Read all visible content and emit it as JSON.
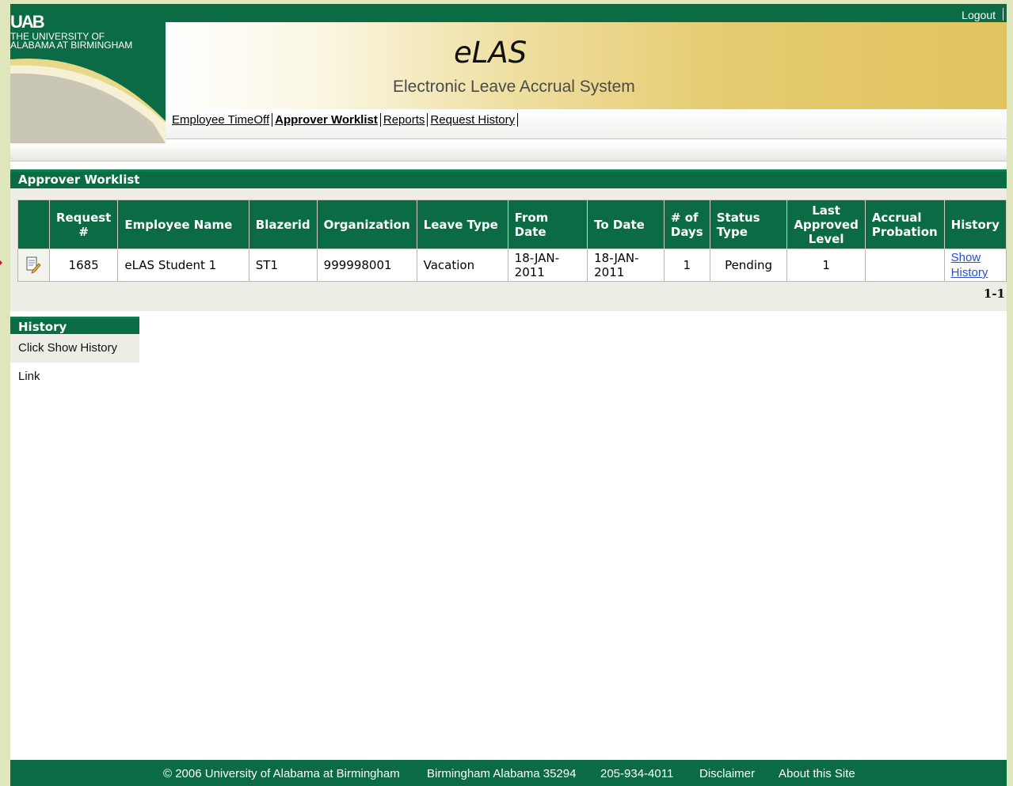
{
  "header": {
    "logo_mark": "UAB",
    "university_name": "THE UNIVERSITY OF\nALABAMA AT BIRMINGHAM",
    "logout_label": "Logout",
    "app_title": "eLAS",
    "app_subtitle": "Electronic Leave Accrual System"
  },
  "nav": {
    "items": [
      {
        "label": "Employee TimeOff"
      },
      {
        "label": "Approver Worklist"
      },
      {
        "label": "Reports"
      },
      {
        "label": "Request History"
      }
    ]
  },
  "worklist": {
    "title": "Approver Worklist",
    "columns": {
      "request": "Request #",
      "employee_name": "Employee Name",
      "blazerid": "Blazerid",
      "organization": "Organization",
      "leave_type": "Leave Type",
      "from_date": "From Date",
      "to_date": "To Date",
      "days": "# of Days",
      "status_type": "Status Type",
      "last_approved_level": "Last Approved Level",
      "accrual_probation": "Accrual Probation",
      "history": "History"
    },
    "rows": [
      {
        "request": "1685",
        "employee_name": "eLAS Student 1",
        "blazerid": "ST1",
        "organization": "999998001",
        "leave_type": "Vacation",
        "from_date": "18-JAN-2011",
        "to_date": "18-JAN-2011",
        "days": "1",
        "status_type": "Pending",
        "last_approved_level": "1",
        "accrual_probation": "",
        "history_link_line1": "Show",
        "history_link_line2": "History"
      }
    ],
    "pager": "1-1"
  },
  "history_panel": {
    "title": "History",
    "text": "Click Show History Link"
  },
  "footer": {
    "copyright": "© 2006 University of Alabama at Birmingham",
    "address": "Birmingham Alabama 35294",
    "phone": "205-934-4011",
    "disclaimer": "Disclaimer",
    "about": "About this Site"
  },
  "colors": {
    "brand_green": "#0b6b45",
    "banner_gold": "#e1c35f",
    "outer_background": "#dfe6bb",
    "link_blue": "#2b4fd1",
    "marker_red": "#c41a16"
  }
}
